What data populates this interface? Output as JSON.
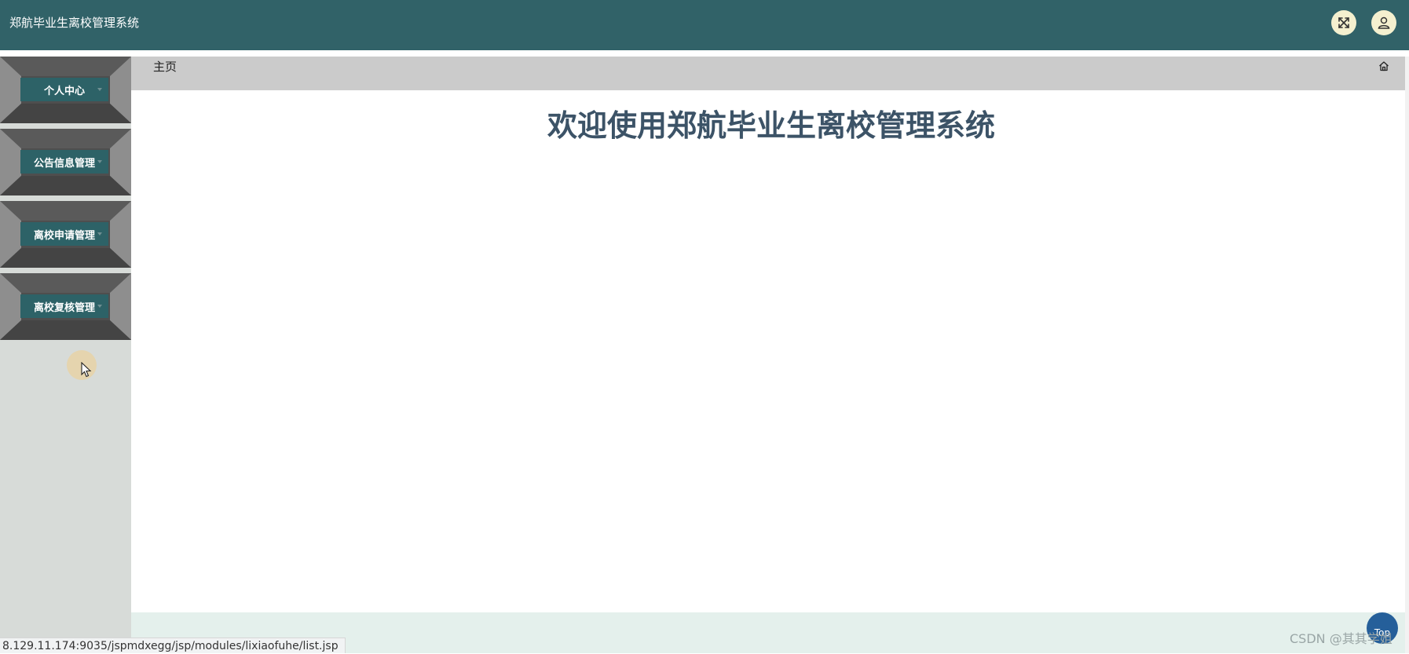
{
  "header": {
    "title": "郑航毕业生离校管理系统",
    "fullscreen_icon": "expand-arrows-icon",
    "user_icon": "user-icon"
  },
  "sidebar": {
    "items": [
      {
        "label": "个人中心"
      },
      {
        "label": "公告信息管理"
      },
      {
        "label": "离校申请管理"
      },
      {
        "label": "离校复核管理"
      }
    ]
  },
  "breadcrumb": {
    "label": "主页",
    "home_icon": "home-icon"
  },
  "main": {
    "welcome": "欢迎使用郑航毕业生离校管理系统"
  },
  "status_bar": {
    "url": "8.129.11.174:9035/jspmdxegg/jsp/modules/lixiaofuhe/list.jsp"
  },
  "back_to_top": {
    "label": "Top"
  },
  "watermark": {
    "text": "CSDN @其其学姐"
  },
  "colors": {
    "header_bg": "#316268",
    "menu_label_bg": "#2d6267",
    "menu_block_bg": "#4e4e4e",
    "sidebar_bg": "#d7dbd8",
    "breadcrumb_bg": "#cbcbcb",
    "welcome_text": "#3c5367",
    "footer_bg": "#e4f0ec"
  }
}
